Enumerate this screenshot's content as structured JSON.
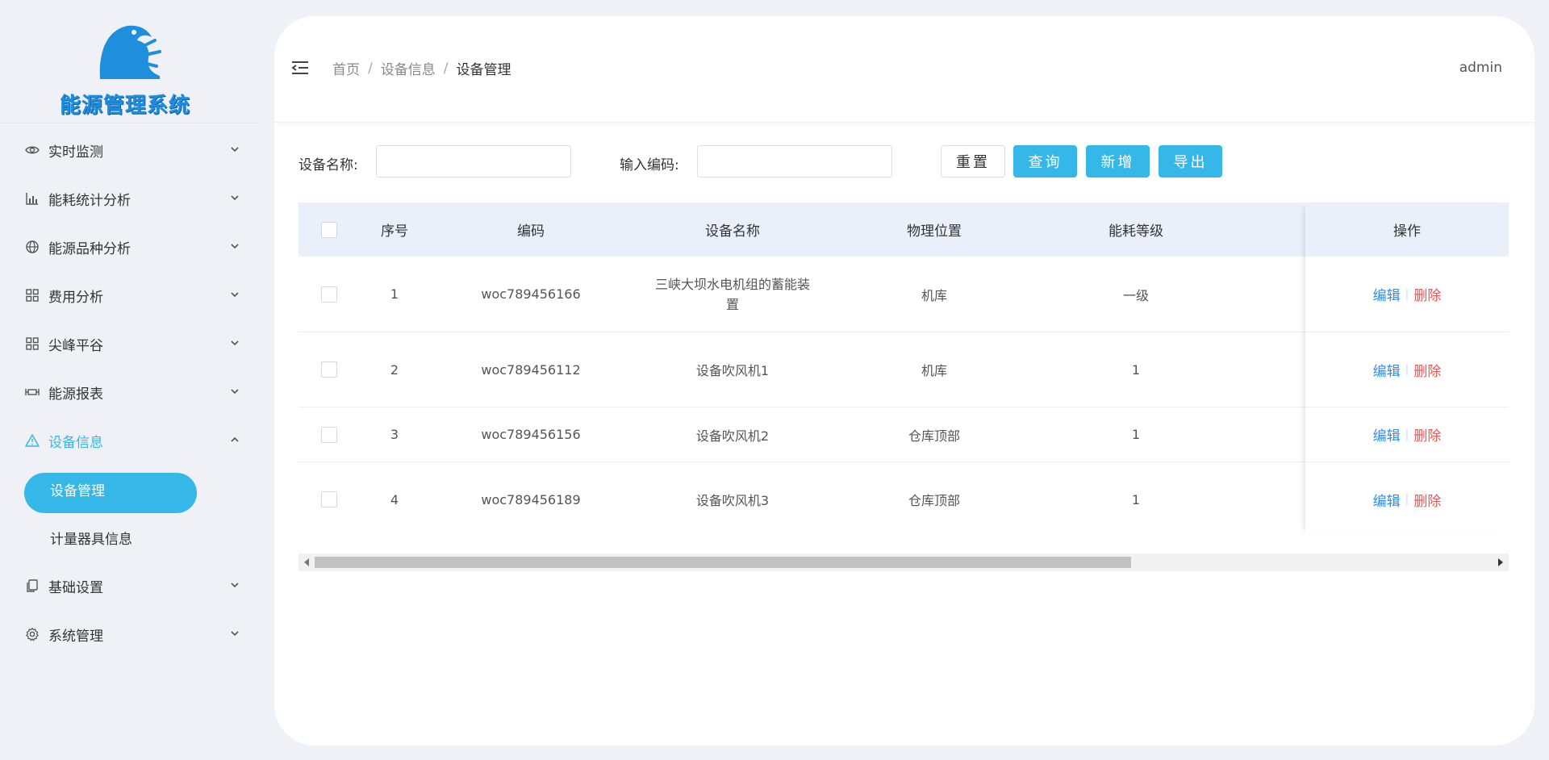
{
  "app": {
    "logo_text": "能源管理系统"
  },
  "sidebar": {
    "items": [
      {
        "label": "实时监测",
        "icon": "eye-icon"
      },
      {
        "label": "能耗统计分析",
        "icon": "bar-chart-icon"
      },
      {
        "label": "能源品种分析",
        "icon": "globe-icon"
      },
      {
        "label": "费用分析",
        "icon": "grid-icon"
      },
      {
        "label": "尖峰平谷",
        "icon": "grid-icon"
      },
      {
        "label": "能源报表",
        "icon": "report-icon"
      },
      {
        "label": "设备信息",
        "icon": "warning-triangle-icon",
        "expanded": true,
        "children": [
          {
            "label": "设备管理",
            "active": true
          },
          {
            "label": "计量器具信息"
          }
        ]
      },
      {
        "label": "基础设置",
        "icon": "copy-icon"
      },
      {
        "label": "系统管理",
        "icon": "gear-icon"
      }
    ]
  },
  "header": {
    "breadcrumb": [
      "首页",
      "设备信息",
      "设备管理"
    ],
    "separator": "/",
    "user": "admin"
  },
  "form": {
    "name_label": "设备名称:",
    "name_value": "",
    "code_label": "输入编码:",
    "code_value": "",
    "reset_label": "重置",
    "search_label": "查询",
    "add_label": "新增",
    "export_label": "导出"
  },
  "table": {
    "columns": [
      "序号",
      "编码",
      "设备名称",
      "物理位置",
      "能耗等级",
      "操作"
    ],
    "edit_label": "编辑",
    "delete_label": "删除",
    "action_separator": "|",
    "rows": [
      {
        "index": "1",
        "code": "woc789456166",
        "name": "三峡大坝水电机组的蓄能装置",
        "name_line1": "三峡大坝水电机组的蓄能装",
        "name_line2": "置",
        "location": "机库",
        "level": "一级"
      },
      {
        "index": "2",
        "code": "woc789456112",
        "name": "设备吹风机1",
        "location": "机库",
        "level": "1"
      },
      {
        "index": "3",
        "code": "woc789456156",
        "name": "设备吹风机2",
        "location": "仓库顶部",
        "level": "1"
      },
      {
        "index": "4",
        "code": "woc789456189",
        "name": "设备吹风机3",
        "location": "仓库顶部",
        "level": "1"
      }
    ]
  },
  "colors": {
    "accent": "#35b8e8",
    "edit": "#2d8cf0",
    "delete": "#f05353",
    "header_bg": "#e9f0fa"
  }
}
